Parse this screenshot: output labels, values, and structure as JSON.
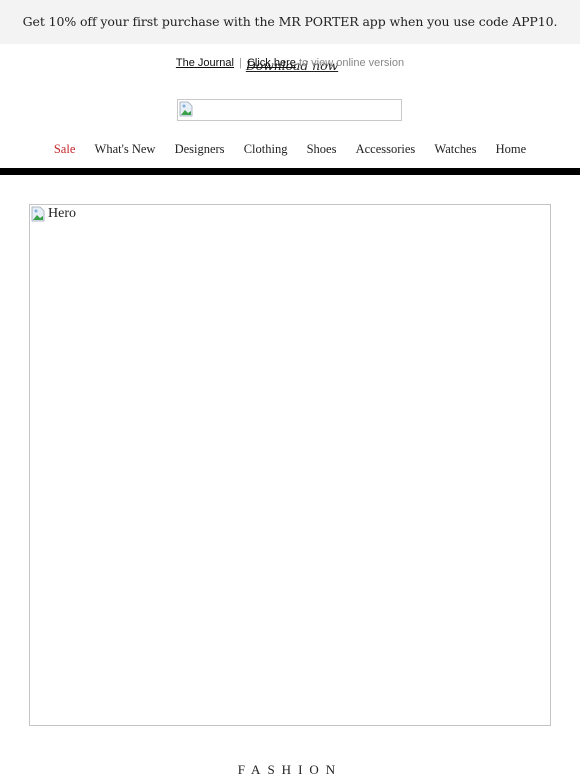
{
  "promo": {
    "text": "Get 10% off your first purchase with the MR PORTER app when you use code APP10.",
    "link_label": "Download now"
  },
  "utility": {
    "journal_label": "The Journal",
    "separator": "|",
    "click_label": "Click here",
    "suffix": "to view online version"
  },
  "logo": {
    "icon": "broken-image-icon"
  },
  "nav": {
    "items": [
      {
        "label": "Sale"
      },
      {
        "label": "What's New"
      },
      {
        "label": "Designers"
      },
      {
        "label": "Clothing"
      },
      {
        "label": "Shoes"
      },
      {
        "label": "Accessories"
      },
      {
        "label": "Watches"
      },
      {
        "label": "Home"
      }
    ]
  },
  "hero": {
    "alt": "Hero",
    "icon": "broken-image-icon"
  },
  "section": {
    "title": "FASHION"
  },
  "colors": {
    "sale": "#c4272b",
    "promo_bg": "#f3f3f3",
    "bar": "#000000"
  }
}
